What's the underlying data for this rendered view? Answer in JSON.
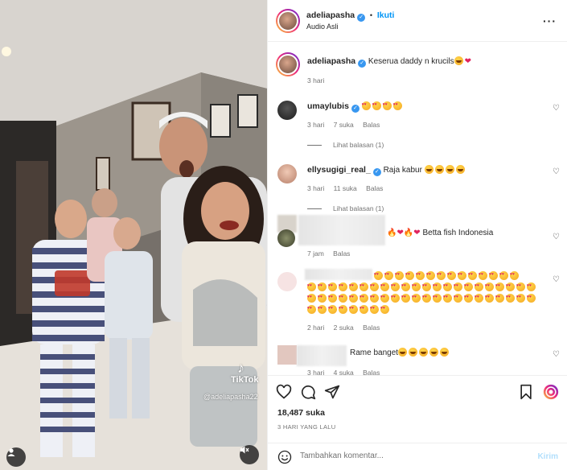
{
  "media": {
    "watermark": "TikTok",
    "watermark_handle": "@adeliapasha22",
    "user_icon": "user-icon",
    "sound_icon": "speaker-muted-icon"
  },
  "header": {
    "username": "adeliapasha",
    "separator": "•",
    "follow_label": "Ikuti",
    "audio": "Audio Asli",
    "more_icon": "more-horizontal-icon"
  },
  "caption": {
    "username": "adeliapasha",
    "text": "Keserua daddy n krucils",
    "time": "3 hari"
  },
  "comments": [
    {
      "username": "umaylubis",
      "text": "",
      "time": "3 hari",
      "likes": "7 suka",
      "reply": "Balas",
      "view_replies": "Lihat balasan (1)"
    },
    {
      "username": "ellysugigi_real_",
      "text": "Raja kabur",
      "time": "3 hari",
      "likes": "11 suka",
      "reply": "Balas",
      "view_replies": "Lihat balasan (1)"
    },
    {
      "username": "",
      "text": "Betta fish Indonesia",
      "time": "7 jam",
      "reply": "Balas"
    },
    {
      "username": "",
      "text": "",
      "time": "2 hari",
      "likes": "2 suka",
      "reply": "Balas"
    },
    {
      "username": "",
      "text": "Rame banget",
      "time": "3 hari",
      "likes": "4 suka",
      "reply": "Balas"
    }
  ],
  "stats": {
    "likes": "18,487 suka",
    "date": "3 HARI YANG LALU"
  },
  "composer": {
    "placeholder": "Tambahkan komentar...",
    "post_label": "Kirim"
  },
  "colors": {
    "accent": "#0095f6",
    "verified": "#3897f0",
    "muted": "#737373"
  }
}
